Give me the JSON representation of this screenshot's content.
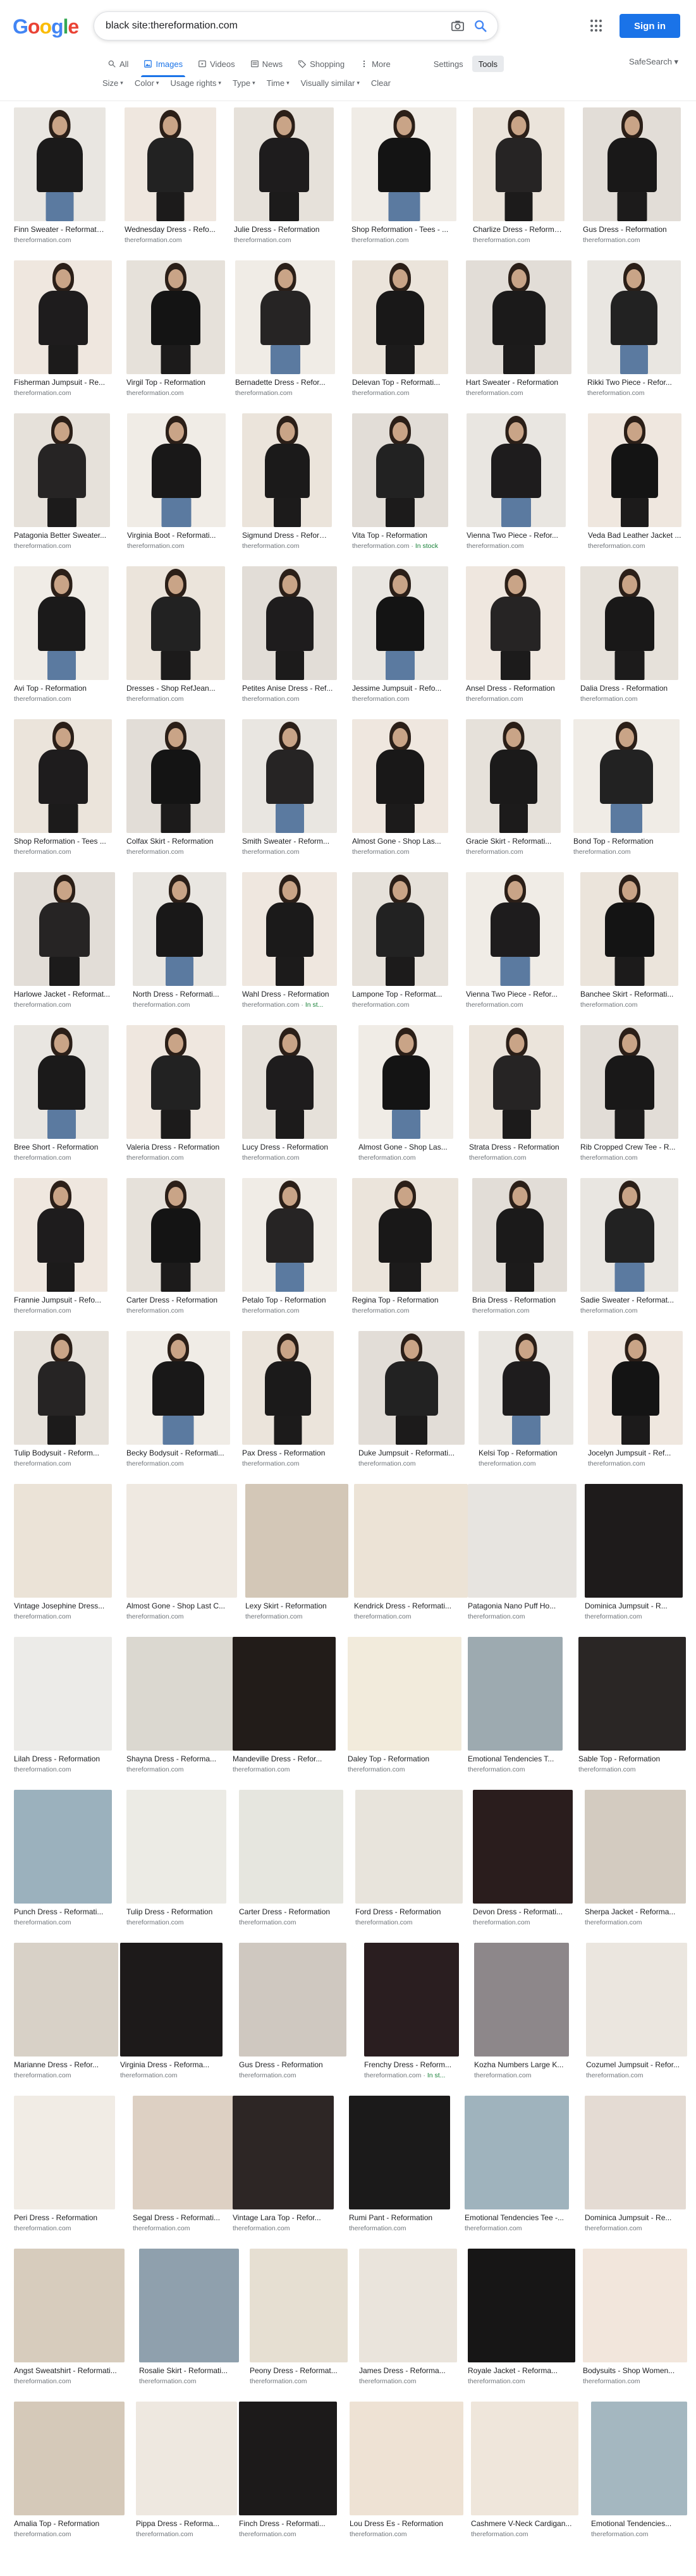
{
  "header": {
    "logo": [
      "G",
      "o",
      "o",
      "g",
      "l",
      "e"
    ],
    "logo_colors": [
      "#4285f4",
      "#ea4335",
      "#fbbc05",
      "#4285f4",
      "#34a853",
      "#ea4335"
    ],
    "search_value": "black site:thereformation.com",
    "sign_in": "Sign in"
  },
  "tabs": [
    {
      "label": "All",
      "icon": "search-icon"
    },
    {
      "label": "Images",
      "icon": "image-icon",
      "active": true
    },
    {
      "label": "Videos",
      "icon": "video-icon"
    },
    {
      "label": "News",
      "icon": "news-icon"
    },
    {
      "label": "Shopping",
      "icon": "tag-icon"
    },
    {
      "label": "More",
      "icon": "more-icon"
    }
  ],
  "settings_label": "Settings",
  "tools_label": "Tools",
  "safesearch": "SafeSearch ▾",
  "filters": [
    "Size",
    "Color",
    "Usage rights",
    "Type",
    "Time",
    "Visually similar"
  ],
  "clear_label": "Clear",
  "colors": {
    "accent": "#1a73e8",
    "in_stock": "#188038"
  },
  "results": [
    [
      {
        "title": "Finn Sweater - Reformation",
        "source": "thereformation.com"
      },
      {
        "title": "Wednesday Dress - Refo...",
        "source": "thereformation.com"
      },
      {
        "title": "Julie Dress - Reformation",
        "source": "thereformation.com"
      },
      {
        "title": "Shop Reformation - Tees - ...",
        "source": "thereformation.com"
      },
      {
        "title": "Charlize Dress - Reformati...",
        "source": "thereformation.com"
      },
      {
        "title": "Gus Dress - Reformation",
        "source": "thereformation.com"
      }
    ],
    [
      {
        "title": "Fisherman Jumpsuit - Re...",
        "source": "thereformation.com"
      },
      {
        "title": "Virgil Top - Reformation",
        "source": "thereformation.com"
      },
      {
        "title": "Bernadette Dress - Refor...",
        "source": "thereformation.com"
      },
      {
        "title": "Delevan Top - Reformati...",
        "source": "thereformation.com"
      },
      {
        "title": "Hart Sweater - Reformation",
        "source": "thereformation.com"
      },
      {
        "title": "Rikki Two Piece - Refor...",
        "source": "thereformation.com"
      }
    ],
    [
      {
        "title": "Patagonia Better Sweater...",
        "source": "thereformation.com"
      },
      {
        "title": "Virginia Boot - Reformati...",
        "source": "thereformation.com"
      },
      {
        "title": "Sigmund Dress - Reforma...",
        "source": "thereformation.com"
      },
      {
        "title": "Vita Top - Reformation",
        "source": "thereformation.com",
        "badge": "In stock"
      },
      {
        "title": "Vienna Two Piece - Refor...",
        "source": "thereformation.com"
      },
      {
        "title": "Veda Bad Leather Jacket ...",
        "source": "thereformation.com"
      }
    ],
    [
      {
        "title": "Avi Top - Reformation",
        "source": "thereformation.com"
      },
      {
        "title": "Dresses - Shop RefJean...",
        "source": "thereformation.com"
      },
      {
        "title": "Petites Anise Dress - Ref...",
        "source": "thereformation.com"
      },
      {
        "title": "Jessime Jumpsuit - Refo...",
        "source": "thereformation.com"
      },
      {
        "title": "Ansel Dress - Reformation",
        "source": "thereformation.com"
      },
      {
        "title": "Dalia Dress - Reformation",
        "source": "thereformation.com"
      }
    ],
    [
      {
        "title": "Shop Reformation - Tees ...",
        "source": "thereformation.com"
      },
      {
        "title": "Colfax Skirt - Reformation",
        "source": "thereformation.com"
      },
      {
        "title": "Smith Sweater - Reform...",
        "source": "thereformation.com"
      },
      {
        "title": "Almost Gone - Shop Las...",
        "source": "thereformation.com"
      },
      {
        "title": "Gracie Skirt - Reformati...",
        "source": "thereformation.com"
      },
      {
        "title": "Bond Top - Reformation",
        "source": "thereformation.com"
      }
    ],
    [
      {
        "title": "Harlowe Jacket - Reformat...",
        "source": "thereformation.com"
      },
      {
        "title": "North Dress - Reformati...",
        "source": "thereformation.com"
      },
      {
        "title": "Wahl Dress - Reformation",
        "source": "thereformation.com",
        "badge": "In st..."
      },
      {
        "title": "Lampone Top - Reformat...",
        "source": "thereformation.com"
      },
      {
        "title": "Vienna Two Piece - Refor...",
        "source": "thereformation.com"
      },
      {
        "title": "Banchee Skirt - Reformati...",
        "source": "thereformation.com"
      }
    ],
    [
      {
        "title": "Bree Short - Reformation",
        "source": "thereformation.com"
      },
      {
        "title": "Valeria Dress - Reformation",
        "source": "thereformation.com"
      },
      {
        "title": "Lucy Dress - Reformation",
        "source": "thereformation.com"
      },
      {
        "title": "Almost Gone - Shop Las...",
        "source": "thereformation.com"
      },
      {
        "title": "Strata Dress - Reformation",
        "source": "thereformation.com"
      },
      {
        "title": "Rib Cropped Crew Tee - R...",
        "source": "thereformation.com"
      }
    ],
    [
      {
        "title": "Frannie Jumpsuit - Refo...",
        "source": "thereformation.com"
      },
      {
        "title": "Carter Dress - Reformation",
        "source": "thereformation.com"
      },
      {
        "title": "Petalo Top - Reformation",
        "source": "thereformation.com"
      },
      {
        "title": "Regina Top - Reformation",
        "source": "thereformation.com"
      },
      {
        "title": "Bria Dress - Reformation",
        "source": "thereformation.com"
      },
      {
        "title": "Sadie Sweater - Reformat...",
        "source": "thereformation.com"
      }
    ],
    [
      {
        "title": "Tulip Bodysuit - Reform...",
        "source": "thereformation.com"
      },
      {
        "title": "Becky Bodysuit - Reformati...",
        "source": "thereformation.com"
      },
      {
        "title": "Pax Dress - Reformation",
        "source": "thereformation.com"
      },
      {
        "title": "Duke Jumpsuit - Reformati...",
        "source": "thereformation.com"
      },
      {
        "title": "Kelsi Top - Reformation",
        "source": "thereformation.com"
      },
      {
        "title": "Jocelyn Jumpsuit - Ref...",
        "source": "thereformation.com"
      }
    ],
    [
      {
        "title": "Vintage Josephine Dress...",
        "source": "thereformation.com"
      },
      {
        "title": "Almost Gone - Shop Last C...",
        "source": "thereformation.com"
      },
      {
        "title": "Lexy Skirt - Reformation",
        "source": "thereformation.com"
      },
      {
        "title": "Kendrick Dress - Reformati...",
        "source": "thereformation.com"
      },
      {
        "title": "Patagonia Nano Puff Ho...",
        "source": "thereformation.com"
      },
      {
        "title": "Dominica Jumpsuit - R...",
        "source": "thereformation.com"
      }
    ],
    [
      {
        "title": "Lilah Dress - Reformation",
        "source": "thereformation.com"
      },
      {
        "title": "Shayna Dress - Reforma...",
        "source": "thereformation.com"
      },
      {
        "title": "Mandeville Dress - Refor...",
        "source": "thereformation.com"
      },
      {
        "title": "Daley Top - Reformation",
        "source": "thereformation.com"
      },
      {
        "title": "Emotional Tendencies T...",
        "source": "thereformation.com"
      },
      {
        "title": "Sable Top - Reformation",
        "source": "thereformation.com"
      }
    ],
    [
      {
        "title": "Punch Dress - Reformati...",
        "source": "thereformation.com"
      },
      {
        "title": "Tulip Dress - Reformation",
        "source": "thereformation.com"
      },
      {
        "title": "Carter Dress - Reformation",
        "source": "thereformation.com"
      },
      {
        "title": "Ford Dress - Reformation",
        "source": "thereformation.com"
      },
      {
        "title": "Devon Dress - Reformati...",
        "source": "thereformation.com"
      },
      {
        "title": "Sherpa Jacket - Reforma...",
        "source": "thereformation.com"
      }
    ],
    [
      {
        "title": "Marianne Dress - Refor...",
        "source": "thereformation.com"
      },
      {
        "title": "Virginia Dress - Reforma...",
        "source": "thereformation.com"
      },
      {
        "title": "Gus Dress - Reformation",
        "source": "thereformation.com"
      },
      {
        "title": "Frenchy Dress - Reform...",
        "source": "thereformation.com",
        "badge": "In st..."
      },
      {
        "title": "Kozha Numbers Large K...",
        "source": "thereformation.com"
      },
      {
        "title": "Cozumel Jumpsuit - Refor...",
        "source": "thereformation.com"
      }
    ],
    [
      {
        "title": "Peri Dress - Reformation",
        "source": "thereformation.com"
      },
      {
        "title": "Segal Dress - Reformati...",
        "source": "thereformation.com"
      },
      {
        "title": "Vintage Lara Top - Refor...",
        "source": "thereformation.com"
      },
      {
        "title": "Rumi Pant - Reformation",
        "source": "thereformation.com"
      },
      {
        "title": "Emotional Tendencies Tee -...",
        "source": "thereformation.com"
      },
      {
        "title": "Dominica Jumpsuit - Re...",
        "source": "thereformation.com"
      }
    ],
    [
      {
        "title": "Angst Sweatshirt - Reformati...",
        "source": "thereformation.com"
      },
      {
        "title": "Rosalie Skirt - Reformati...",
        "source": "thereformation.com"
      },
      {
        "title": "Peony Dress - Reformat...",
        "source": "thereformation.com"
      },
      {
        "title": "James Dress - Reforma...",
        "source": "thereformation.com"
      },
      {
        "title": "Royale Jacket - Reforma...",
        "source": "thereformation.com"
      },
      {
        "title": "Bodysuits - Shop Women...",
        "source": "thereformation.com"
      }
    ],
    [
      {
        "title": "Amalia Top - Reformation",
        "source": "thereformation.com"
      },
      {
        "title": "Pippa Dress - Reforma...",
        "source": "thereformation.com"
      },
      {
        "title": "Finch Dress - Reformati...",
        "source": "thereformation.com"
      },
      {
        "title": "Lou Dress Es - Reformation",
        "source": "thereformation.com"
      },
      {
        "title": "Cashmere V-Neck Cardigan...",
        "source": "thereformation.com"
      },
      {
        "title": "Emotional Tendencies...",
        "source": "thereformation.com"
      }
    ]
  ]
}
